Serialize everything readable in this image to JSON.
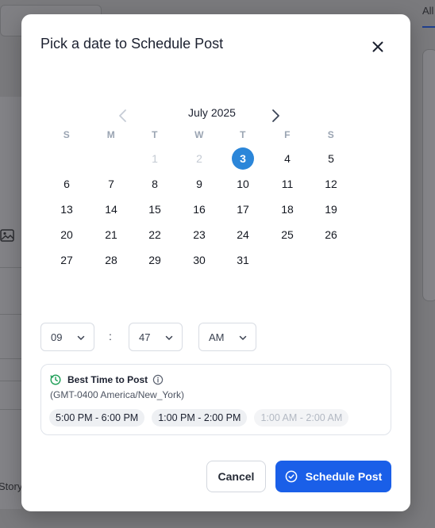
{
  "background": {
    "tab_label": "All",
    "side_text": "Story"
  },
  "modal": {
    "title": "Pick a date to Schedule Post"
  },
  "calendar": {
    "month_label": "July 2025",
    "weekdays": [
      "S",
      "M",
      "T",
      "W",
      "T",
      "F",
      "S"
    ],
    "days": [
      "1",
      "2",
      "3",
      "4",
      "5",
      "6",
      "7",
      "8",
      "9",
      "10",
      "11",
      "12",
      "13",
      "14",
      "15",
      "16",
      "17",
      "18",
      "19",
      "20",
      "21",
      "22",
      "23",
      "24",
      "25",
      "26",
      "27",
      "28",
      "29",
      "30",
      "31"
    ],
    "disabled_days": [
      "1",
      "2"
    ],
    "selected_day": "3"
  },
  "time": {
    "hour": "09",
    "separator": ":",
    "minute": "47",
    "period": "AM"
  },
  "best_time": {
    "title": "Best Time to Post",
    "timezone": "(GMT-0400 America/New_York)",
    "slots": [
      "5:00 PM - 6:00 PM",
      "1:00 PM - 2:00 PM",
      "1:00 AM - 2:00 AM"
    ],
    "muted_slot": "1:00 AM - 2:00 AM"
  },
  "footer": {
    "cancel_label": "Cancel",
    "schedule_label": "Schedule Post"
  },
  "colors": {
    "accent": "#1a5fe8",
    "selected_day": "#2b86d9",
    "best_time_icon": "#1e9e57"
  },
  "icons": {
    "close": "close-icon",
    "prev": "chevron-left-icon",
    "next": "chevron-right-icon",
    "dropdown": "chevron-down-icon",
    "clock": "clock-icon",
    "info": "info-icon",
    "check": "check-circle-icon"
  }
}
